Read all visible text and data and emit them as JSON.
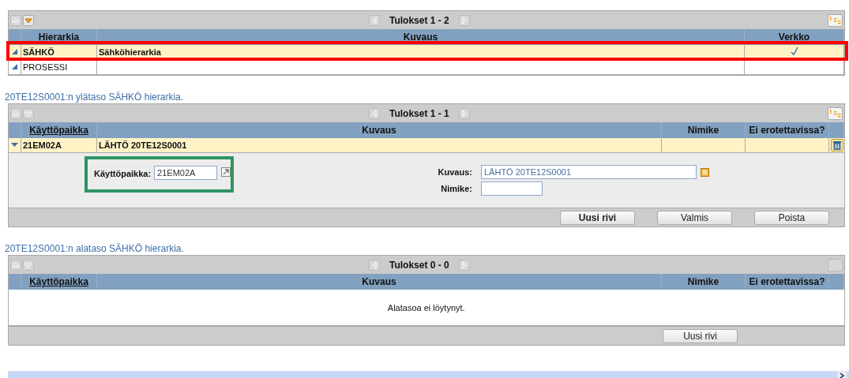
{
  "panels": [
    {
      "toolbar": {
        "up_enabled": false,
        "down_enabled": true,
        "results": "Tulokset 1 - 2",
        "numbering_enabled": true
      },
      "columns": [
        {
          "label": "Hierarkia",
          "kind": "text"
        },
        {
          "label": "Kuvaus",
          "kind": "text"
        },
        {
          "label": "Verkko",
          "kind": "check"
        }
      ],
      "rows": [
        {
          "cells": [
            "SÄHKÖ",
            "Sähköhierarkia"
          ],
          "checked": true,
          "selected": true,
          "expanded": false,
          "highlighted": true
        },
        {
          "cells": [
            "PROSESSI"
          ],
          "selected": false,
          "expanded": false
        }
      ]
    },
    {
      "caption": "20TE12S0001:n ylätaso SÄHKÖ hierarkia.",
      "toolbar": {
        "up_enabled": false,
        "down_enabled": false,
        "results": "Tulokset 1 - 1",
        "numbering_enabled": true
      },
      "columns": [
        {
          "label": "Käyttöpaikka",
          "sortable": true,
          "kind": "text"
        },
        {
          "label": "Kuvaus",
          "sortable": false,
          "kind": "text"
        },
        {
          "label": "Nimike",
          "sortable": false,
          "kind": "text"
        },
        {
          "label": "Ei erotettavissa?",
          "sortable": false,
          "kind": "text"
        }
      ],
      "rows": [
        {
          "cells": [
            "21EM02A",
            "LÄHTÖ 20TE12S0001"
          ],
          "selected": true,
          "expanded": true,
          "deletable": true
        }
      ],
      "detail": {
        "left": [
          {
            "label": "Käyttöpaikka:",
            "value": "21EM02A",
            "highlighted": true
          }
        ],
        "right": [
          {
            "label": "Kuvaus:",
            "value": "LÄHTÖ 20TE12S0001",
            "wide": true
          },
          {
            "label": "Nimike:",
            "wide": false
          }
        ]
      },
      "buttons": [
        {
          "label": "Uusi rivi",
          "default": true
        },
        {
          "label": "Valmis",
          "default": false
        },
        {
          "label": "Poista",
          "default": false
        }
      ]
    },
    {
      "caption": "20TE12S0001:n alataso SÄHKÖ hierarkia.",
      "toolbar": {
        "up_enabled": false,
        "down_enabled": false,
        "results": "Tulokset 0 - 0",
        "numbering_enabled": false
      },
      "columns": [
        {
          "label": "Käyttöpaikka",
          "sortable": true
        },
        {
          "label": "Kuvaus",
          "sortable": false
        },
        {
          "label": "Nimike",
          "sortable": false
        },
        {
          "label": "Ei erotettavissa?",
          "sortable": false
        }
      ],
      "empty_message": "Alatasoa ei löytynyt.",
      "buttons": [
        {
          "label": "Uusi rivi",
          "default": false
        }
      ]
    }
  ]
}
